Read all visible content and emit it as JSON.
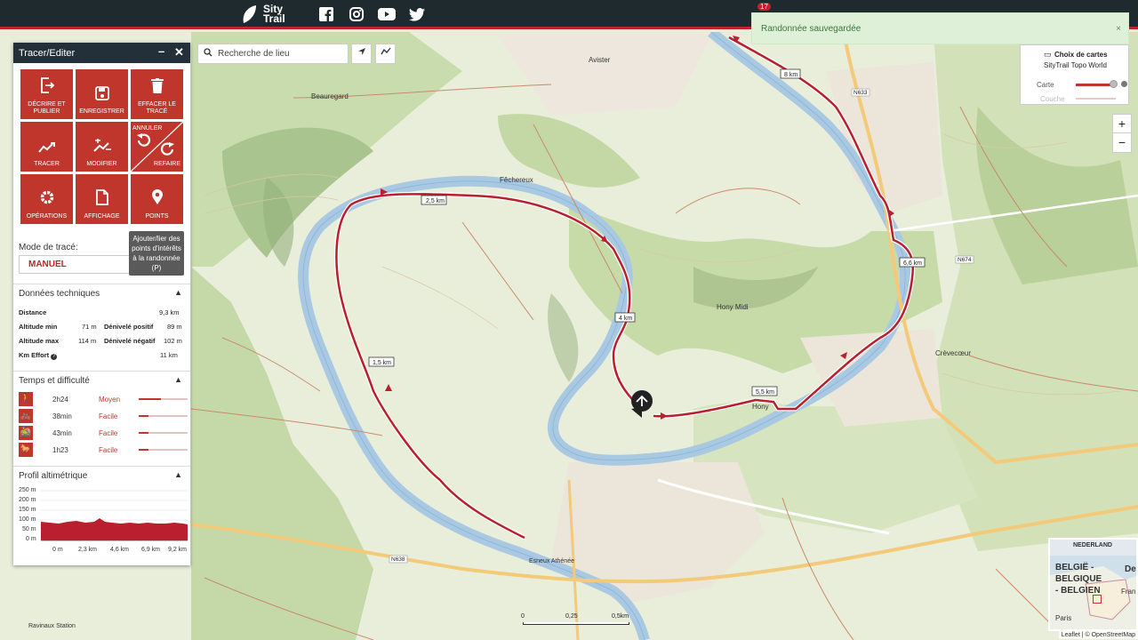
{
  "app": {
    "logo_line1": "Sity",
    "logo_line2": "Trail",
    "notification_count": "17"
  },
  "social_icons": [
    "facebook-icon",
    "instagram-icon",
    "youtube-icon",
    "twitter-icon"
  ],
  "panel": {
    "title": "Tracer/Editer",
    "buttons": [
      {
        "label": "DÉCRIRE ET PUBLIER",
        "icon": "export-icon"
      },
      {
        "label": "ENREGISTRER",
        "icon": "save-icon"
      },
      {
        "label": "EFFACER LE TRACÉ",
        "icon": "trash-icon"
      },
      {
        "label": "TRACER",
        "icon": "trace-icon"
      },
      {
        "label": "MODIFIER",
        "icon": "edit-track-icon"
      },
      {
        "label_undo": "ANNULER",
        "label_redo": "REFAIRE",
        "icon": "undo-redo-icon"
      },
      {
        "label": "OPÉRATIONS",
        "icon": "gear-icon"
      },
      {
        "label": "AFFICHAGE",
        "icon": "file-icon"
      },
      {
        "label": "POINTS",
        "icon": "map-pin-icon"
      }
    ],
    "tooltip": "Ajouter/lier des points d'intérêts à la randonnée (P)",
    "mode_label": "Mode de tracé:",
    "mode_value": "MANUEL",
    "tech_title": "Données techniques",
    "tech": {
      "distance_label": "Distance",
      "distance_value": "9,3 km",
      "alt_min_label": "Altitude min",
      "alt_min_value": "71 m",
      "pos_label": "Dénivelé positif",
      "pos_value": "89 m",
      "alt_max_label": "Altitude max",
      "alt_max_value": "114 m",
      "neg_label": "Dénivelé négatif",
      "neg_value": "102 m",
      "effort_label": "Km Effort",
      "effort_value": "11 km"
    },
    "difficulty_title": "Temps et difficulté",
    "difficulty": [
      {
        "time": "2h24",
        "level": "Moyen",
        "icon": "hiker-icon",
        "fill": 0.45
      },
      {
        "time": "38min",
        "level": "Facile",
        "icon": "bike-icon",
        "fill": 0.2
      },
      {
        "time": "43min",
        "level": "Facile",
        "icon": "mtb-icon",
        "fill": 0.2
      },
      {
        "time": "1h23",
        "level": "Facile",
        "icon": "horse-icon",
        "fill": 0.2
      }
    ],
    "profile_title": "Profil altimétrique",
    "profile_y_ticks": [
      "250 m",
      "200 m",
      "150 m",
      "100 m",
      "50 m",
      "0 m"
    ],
    "profile_x_ticks": [
      "0 m",
      "2,3 km",
      "4,6 km",
      "6,9 km",
      "9,2 km"
    ]
  },
  "search": {
    "placeholder": "Recherche de lieu"
  },
  "toast": {
    "message": "Randonnée sauvegardée",
    "close": "×"
  },
  "layers": {
    "title": "Choix de cartes",
    "subtitle": "SityTrail Topo World",
    "row1": "Carte",
    "row2": "Couche"
  },
  "zoom": {
    "in": "+",
    "out": "−"
  },
  "map_labels": {
    "km_markers": [
      "2,5 km",
      "4 km",
      "1,5 km",
      "5,5 km",
      "6,6 km",
      "8 km"
    ],
    "places": [
      "Avister",
      "Beauregard",
      "Fêchereux",
      "Hony Midi",
      "Hony",
      "Crèvecœur",
      "Esneux Athénée",
      "Ravinaux Station"
    ],
    "roads": [
      "N633",
      "N674",
      "N638"
    ]
  },
  "minimap": {
    "l1": "NEDERLAND",
    "l2": "BELGIË -",
    "l3": "BELGIQUE",
    "l4": "- BELGIEN",
    "l5": "Paris",
    "l6": "De",
    "l7": "Frank"
  },
  "scale": {
    "s0": "0",
    "s1": "0,25",
    "s2": "0,5km"
  },
  "attribution": "Leaflet | © OpenStreetMap"
}
